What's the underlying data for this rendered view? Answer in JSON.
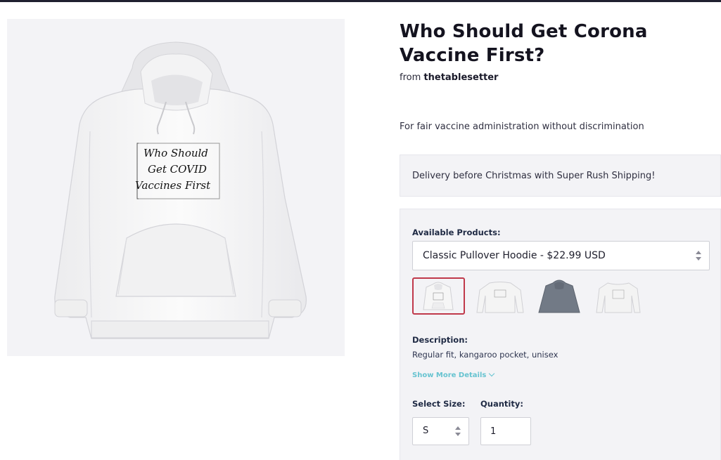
{
  "product": {
    "title": "Who Should Get Corona Vaccine First?",
    "from_label": "from",
    "store_name": "thetablesetter",
    "tagline": "For fair vaccine administration without discrimination",
    "print_lines": [
      "Who Should",
      "Get COVID",
      "Vaccines First"
    ]
  },
  "delivery_banner": "Delivery before Christmas with Super Rush Shipping!",
  "options": {
    "available_label": "Available Products:",
    "selected_product": "Classic Pullover Hoodie - $22.99 USD",
    "thumbnails": [
      {
        "name": "white-hoodie",
        "color": "#f4f4f4"
      },
      {
        "name": "white-long-sleeve",
        "color": "#f2f2f2"
      },
      {
        "name": "grey-hoodie",
        "color": "#727a86"
      },
      {
        "name": "white-crewneck",
        "color": "#f2f2f2"
      }
    ],
    "selected_thumbnail_index": 0,
    "description_label": "Description:",
    "description": "Regular fit, kangaroo pocket, unisex",
    "show_more": "Show More Details",
    "size_label": "Select Size:",
    "size_value": "S",
    "quantity_label": "Quantity:",
    "quantity_value": "1"
  },
  "colors": {
    "selected_border": "#c0394b",
    "link": "#66c3d0",
    "panel_bg": "#f3f3f6"
  }
}
